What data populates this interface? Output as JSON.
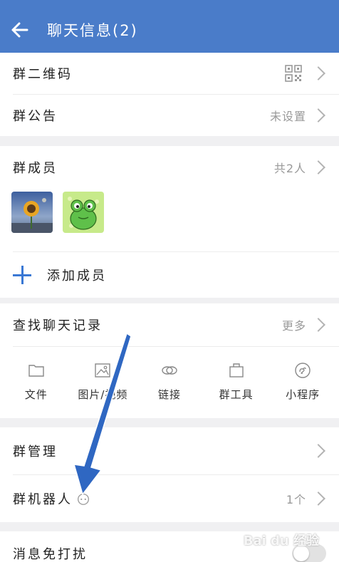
{
  "header": {
    "title": "聊天信息(2)"
  },
  "group_qr": {
    "label": "群二维码"
  },
  "announcement": {
    "label": "群公告",
    "value": "未设置"
  },
  "members": {
    "label": "群成员",
    "count": "共2人",
    "add_label": "添加成员"
  },
  "history": {
    "label": "查找聊天记录",
    "more": "更多",
    "tools": [
      {
        "label": "文件",
        "icon": "folder-icon"
      },
      {
        "label": "图片/视频",
        "icon": "image-icon"
      },
      {
        "label": "链接",
        "icon": "link-icon"
      },
      {
        "label": "群工具",
        "icon": "toolbox-icon"
      },
      {
        "label": "小程序",
        "icon": "mini-program-icon"
      }
    ]
  },
  "manage": {
    "label": "群管理"
  },
  "robot": {
    "label": "群机器人",
    "value": "1个",
    "icon": "robot-icon"
  },
  "dnd": {
    "label": "消息免打扰"
  },
  "watermark": {
    "text": "Bai du 经验"
  },
  "colors": {
    "header": "#4a7cc9",
    "accent": "#3a78d4",
    "arrow": "#2f67c2"
  }
}
